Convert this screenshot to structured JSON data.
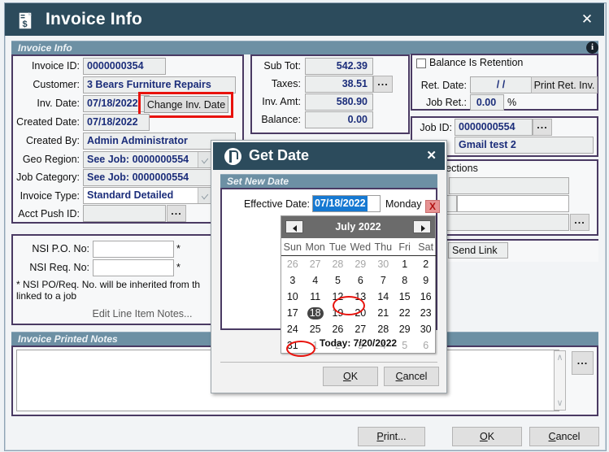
{
  "window": {
    "title": "Invoice Info",
    "close_label": "✕",
    "doc_icon": "invoice-document-icon",
    "info_icon": "i"
  },
  "invoice_info_group": {
    "header": "Invoice Info",
    "fields": [
      {
        "label": "Invoice ID:",
        "value": "0000000354"
      },
      {
        "label": "Customer:",
        "value": "3 Bears Furniture Repairs"
      },
      {
        "label": "Inv. Date:",
        "value": "07/18/2022"
      },
      {
        "label": "Created Date:",
        "value": "07/18/2022"
      },
      {
        "label": "Created By:",
        "value": "Admin Administrator"
      },
      {
        "label": "Geo Region:",
        "value": "See Job: 0000000554"
      },
      {
        "label": "Job Category:",
        "value": "See Job: 0000000554"
      },
      {
        "label": "Invoice Type:",
        "value": "Standard Detailed"
      },
      {
        "label": "Acct Push ID:",
        "value": ""
      }
    ],
    "change_inv_date_button": "Change Inv. Date",
    "acct_push_browse": "..."
  },
  "nsi_panel": {
    "po_label": "NSI P.O. No:",
    "po_value": "",
    "po_star": "*",
    "req_label": "NSI Req. No:",
    "req_value": "",
    "req_star": "*",
    "note_line1": "* NSI PO/Req. No. will be inherited from th",
    "note_line2": "linked to a job",
    "edit_line_item_notes": "Edit Line Item Notes..."
  },
  "totals_panel": {
    "rows": [
      {
        "label": "Sub Tot:",
        "value": "542.39"
      },
      {
        "label": "Taxes:",
        "value": "38.51"
      },
      {
        "label": "Inv. Amt:",
        "value": "580.90"
      },
      {
        "label": "Balance:",
        "value": "0.00"
      }
    ],
    "taxes_browse": "..."
  },
  "retention_panel": {
    "checkbox_label": "Balance Is Retention",
    "checked": false,
    "ret_date_label": "Ret. Date:",
    "ret_date_value": "/  /",
    "print_ret_inv_button": "Print Ret. Inv.",
    "job_ret_label": "Job Ret.:",
    "job_ret_value": "0.00",
    "percent": "%"
  },
  "job_panel": {
    "job_id_label": "Job ID:",
    "job_id_value": "0000000554",
    "job_browse": "...",
    "job_name": "Gmail test 2"
  },
  "collections_panel": {
    "header": "To Collections",
    "field1": "",
    "field2": "",
    "field3": "",
    "field4": "",
    "browse": "..."
  },
  "send_link_button": "Send Link",
  "printed_notes": {
    "header": "Invoice Printed Notes",
    "value": "",
    "browse": "...",
    "scroll_up": "∧",
    "scroll_down": "∨"
  },
  "footer_buttons": {
    "print": "Print...",
    "print_mnemonic": "P",
    "ok": "OK",
    "ok_mnemonic": "O",
    "cancel": "Cancel",
    "cancel_mnemonic": "C"
  },
  "get_date_dialog": {
    "title": "Get Date",
    "close_label": "✕",
    "group_header": "Set New Date",
    "effective_date_label": "Effective Date:",
    "effective_date_value": "07/18/2022",
    "weekday": "Monday",
    "ok": "OK",
    "cancel": "Cancel",
    "x_badge": "X"
  },
  "calendar": {
    "month_title": "July 2022",
    "prev_label": "◄",
    "next_label": "►",
    "weekdays": [
      "Sun",
      "Mon",
      "Tue",
      "Wed",
      "Thu",
      "Fri",
      "Sat"
    ],
    "weeks": [
      [
        {
          "d": "26",
          "o": true
        },
        {
          "d": "27",
          "o": true
        },
        {
          "d": "28",
          "o": true
        },
        {
          "d": "29",
          "o": true
        },
        {
          "d": "30",
          "o": true
        },
        {
          "d": "1"
        },
        {
          "d": "2"
        }
      ],
      [
        {
          "d": "3"
        },
        {
          "d": "4"
        },
        {
          "d": "5"
        },
        {
          "d": "6"
        },
        {
          "d": "7"
        },
        {
          "d": "8"
        },
        {
          "d": "9"
        }
      ],
      [
        {
          "d": "10"
        },
        {
          "d": "11"
        },
        {
          "d": "12"
        },
        {
          "d": "13"
        },
        {
          "d": "14"
        },
        {
          "d": "15"
        },
        {
          "d": "16"
        }
      ],
      [
        {
          "d": "17"
        },
        {
          "d": "18",
          "sel": true
        },
        {
          "d": "19"
        },
        {
          "d": "20",
          "circled": true
        },
        {
          "d": "21"
        },
        {
          "d": "22"
        },
        {
          "d": "23"
        }
      ],
      [
        {
          "d": "24"
        },
        {
          "d": "25"
        },
        {
          "d": "26"
        },
        {
          "d": "27"
        },
        {
          "d": "28"
        },
        {
          "d": "29"
        },
        {
          "d": "30"
        }
      ],
      [
        {
          "d": "31"
        },
        {
          "d": "1",
          "o": true
        },
        {
          "d": "2",
          "o": true
        },
        {
          "d": "3",
          "o": true
        },
        {
          "d": "4",
          "o": true
        },
        {
          "d": "5",
          "o": true
        },
        {
          "d": "6",
          "o": true
        }
      ]
    ],
    "today_text": "Today: 7/20/2022",
    "selected_day": "18",
    "annotated_day": "20"
  },
  "colors": {
    "titlebar": "#2c4b5c",
    "group_header": "#6d90a4",
    "panel_border": "#4a3a63",
    "field_text": "#1b2d7a",
    "annotation_red": "#e8120c",
    "selection_blue": "#1679d2",
    "calendar_header": "#6b6b6b"
  }
}
